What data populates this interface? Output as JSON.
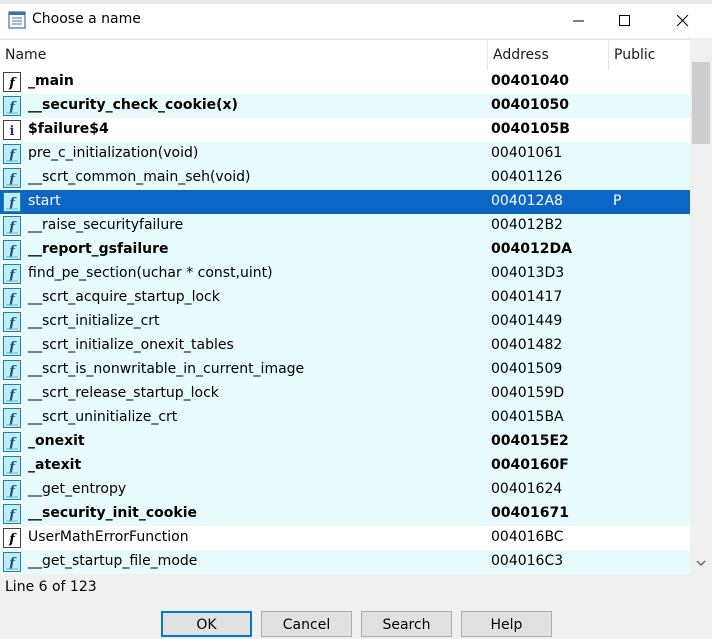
{
  "window": {
    "title": "Choose a name",
    "controls": [
      "minimize",
      "maximize",
      "close"
    ]
  },
  "columns": {
    "name": "Name",
    "address": "Address",
    "public": "Public"
  },
  "rows": [
    {
      "icon": "function-icon",
      "name": "_main",
      "address": "00401040",
      "public": "",
      "bold": true,
      "state": "white"
    },
    {
      "icon": "library-function-icon",
      "name": "__security_check_cookie(x)",
      "address": "00401050",
      "public": "",
      "bold": true,
      "state": "cyan"
    },
    {
      "icon": "info-icon",
      "name": "$failure$4",
      "address": "0040105B",
      "public": "",
      "bold": true,
      "state": "white"
    },
    {
      "icon": "library-function-icon",
      "name": "pre_c_initialization(void)",
      "address": "00401061",
      "public": "",
      "bold": false,
      "state": "cyan"
    },
    {
      "icon": "library-function-icon",
      "name": "__scrt_common_main_seh(void)",
      "address": "00401126",
      "public": "",
      "bold": false,
      "state": "cyan"
    },
    {
      "icon": "library-function-icon",
      "name": "start",
      "address": "004012A8",
      "public": "P",
      "bold": false,
      "state": "sel"
    },
    {
      "icon": "library-function-icon",
      "name": "__raise_securityfailure",
      "address": "004012B2",
      "public": "",
      "bold": false,
      "state": "cyan"
    },
    {
      "icon": "library-function-icon",
      "name": "__report_gsfailure",
      "address": "004012DA",
      "public": "",
      "bold": true,
      "state": "cyan"
    },
    {
      "icon": "library-function-icon",
      "name": "find_pe_section(uchar * const,uint)",
      "address": "004013D3",
      "public": "",
      "bold": false,
      "state": "cyan"
    },
    {
      "icon": "library-function-icon",
      "name": "__scrt_acquire_startup_lock",
      "address": "00401417",
      "public": "",
      "bold": false,
      "state": "cyan"
    },
    {
      "icon": "library-function-icon",
      "name": "__scrt_initialize_crt",
      "address": "00401449",
      "public": "",
      "bold": false,
      "state": "cyan"
    },
    {
      "icon": "library-function-icon",
      "name": "__scrt_initialize_onexit_tables",
      "address": "00401482",
      "public": "",
      "bold": false,
      "state": "cyan"
    },
    {
      "icon": "library-function-icon",
      "name": "__scrt_is_nonwritable_in_current_image",
      "address": "00401509",
      "public": "",
      "bold": false,
      "state": "cyan"
    },
    {
      "icon": "library-function-icon",
      "name": "__scrt_release_startup_lock",
      "address": "0040159D",
      "public": "",
      "bold": false,
      "state": "cyan"
    },
    {
      "icon": "library-function-icon",
      "name": "__scrt_uninitialize_crt",
      "address": "004015BA",
      "public": "",
      "bold": false,
      "state": "cyan"
    },
    {
      "icon": "library-function-icon",
      "name": "_onexit",
      "address": "004015E2",
      "public": "",
      "bold": true,
      "state": "cyan"
    },
    {
      "icon": "library-function-icon",
      "name": "_atexit",
      "address": "0040160F",
      "public": "",
      "bold": true,
      "state": "cyan"
    },
    {
      "icon": "library-function-icon",
      "name": "__get_entropy",
      "address": "00401624",
      "public": "",
      "bold": false,
      "state": "cyan"
    },
    {
      "icon": "library-function-icon",
      "name": "__security_init_cookie",
      "address": "00401671",
      "public": "",
      "bold": true,
      "state": "cyan"
    },
    {
      "icon": "function-icon",
      "name": "UserMathErrorFunction",
      "address": "004016BC",
      "public": "",
      "bold": false,
      "state": "white"
    },
    {
      "icon": "library-function-icon",
      "name": "__get_startup_file_mode",
      "address": "004016C3",
      "public": "",
      "bold": false,
      "state": "cyan"
    }
  ],
  "status": "Line 6 of 123",
  "buttons": {
    "ok": "OK",
    "cancel": "Cancel",
    "search": "Search",
    "help": "Help"
  }
}
